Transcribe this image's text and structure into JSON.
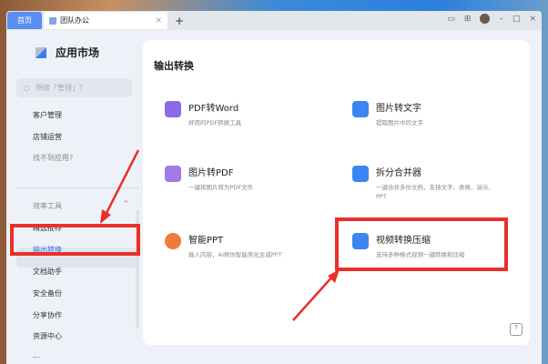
{
  "tabs": {
    "home": "首页",
    "active": "团队办公",
    "close": "×",
    "new": "+"
  },
  "window_controls": {
    "minimize": "–",
    "maximize": "□",
    "close": "×"
  },
  "sidebar": {
    "title": "应用市场",
    "search_placeholder": "想搜「管理」？",
    "top_items": [
      "客户管理",
      "店铺运营"
    ],
    "missing": "找不到应用?",
    "section": "效率工具",
    "items": [
      "精选推荐",
      "输出转换",
      "文档助手",
      "安全备份",
      "分享协作",
      "资源中心",
      "..."
    ],
    "selected": "输出转换"
  },
  "main": {
    "title": "输出转换",
    "cards": [
      {
        "title": "PDF转Word",
        "desc": "好用的PDF转换工具",
        "color": "#8b6be8"
      },
      {
        "title": "图片转文字",
        "desc": "提取图片中的文字",
        "color": "#3a86f0"
      },
      {
        "title": "图片转PDF",
        "desc": "一键将图片转为PDF文件",
        "color": "#a17ae6"
      },
      {
        "title": "拆分合并器",
        "desc": "一键合并多份文档，支持文字、表格、演示、PPT",
        "color": "#3a86f0"
      },
      {
        "title": "智能PPT",
        "desc": "输入内容，AI帮你智能美化生成PPT",
        "color": "#f07a3a"
      },
      {
        "title": "视频转换压缩",
        "desc": "支持多种格式视频一键转换和压缩",
        "color": "#3a86f0"
      }
    ]
  },
  "annotation_color": "#e8302a"
}
